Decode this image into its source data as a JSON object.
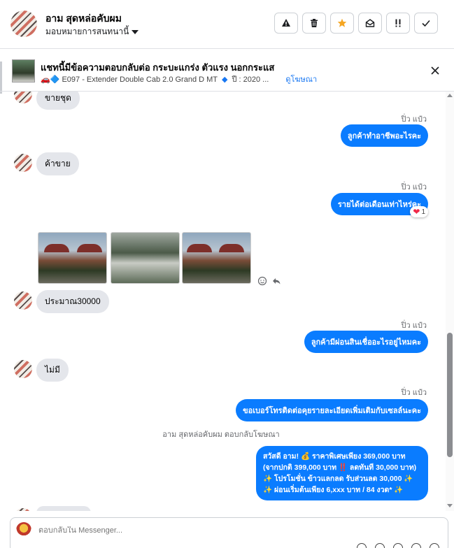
{
  "header": {
    "name": "อาม สุดหล่อคับผม",
    "assign_label": "มอบหมายการสนทนานี้",
    "actions": [
      "mark-spam",
      "delete",
      "star",
      "mark-unread",
      "flag",
      "done"
    ]
  },
  "ad_context": {
    "title": "แชทนี้มีข้อความตอบกลับต่อ กระบะแกร่ง ตัวแรง นอกกระแส",
    "listing": "🚗🔷 E097 - Extender Double Cab 2.0 Grand D MT",
    "year": "ปี : 2020 ...",
    "link": "ดูโฆษณา"
  },
  "messages": {
    "top_partial": "ขายชุด",
    "seller_name": "ปิ่ว แป๋ว",
    "out_1": "ลูกค้าทำอาชีพอะไรคะ",
    "in_1": "ค้าขาย",
    "out_2": "รายได้ต่อเดือนเท่าไหร่คะ",
    "reaction_count": "1",
    "in_2": "ประมาณ30000",
    "out_3": "ลูกค้ามีผ่อนสินเชื่ออะไรอยู่ไหมคะ",
    "in_3": "ไม่มี",
    "out_4": "ขอเบอร์โทรติดต่อคุยรายละเอียดเพิ่มเติมกับเซลล์นะคะ",
    "system_note": "อาม สุดหล่อคับผม ตอบกลับโฆษณา",
    "promo_lines": [
      "สวัสดี อาม! 💰 ราคาพิเศษเพียง 369,000 บาท",
      "(จากปกติ 399,000 บาท ‼️ ลดทันที 30,000 บาท)",
      "✨ โปรโมชั่น ข้าวแลกลด รับส่วนลด 30,000 ✨",
      "✨ ผ่อนเริ่มต้นเพียง 6,xxx บาท / 84 งวด* ✨"
    ]
  },
  "composer": {
    "placeholder": "ตอบกลับใน Messenger..."
  },
  "colors": {
    "accent": "#0a7cff",
    "incoming_bubble": "#e4e6eb",
    "star": "#f5a623"
  }
}
